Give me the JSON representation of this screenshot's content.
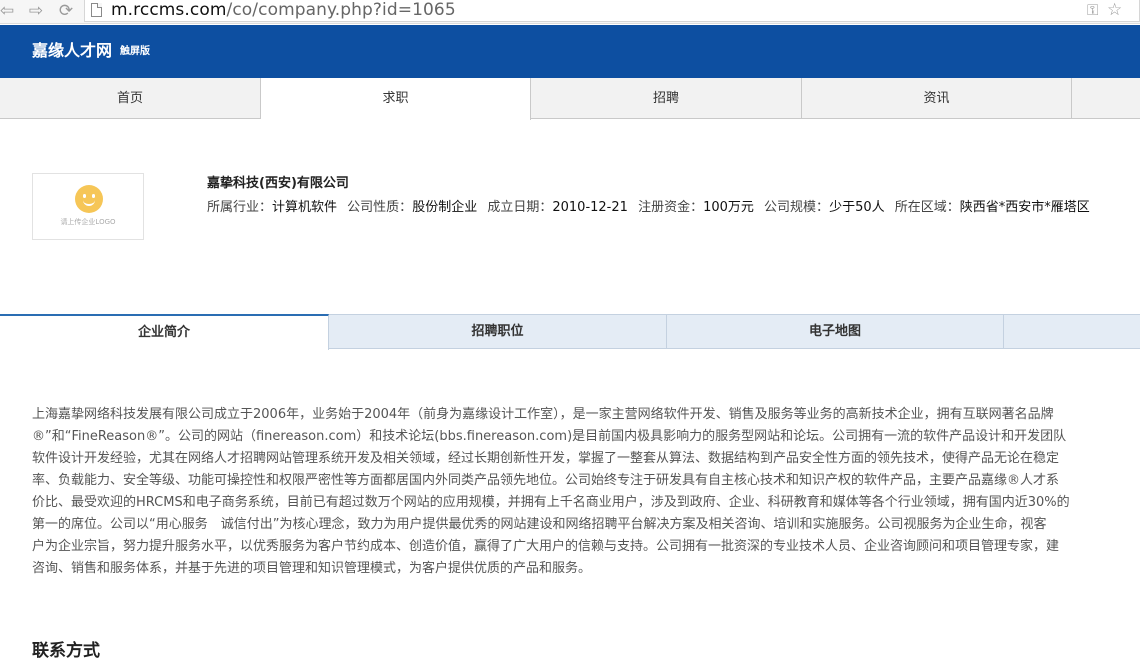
{
  "browser": {
    "url_host": "m.rccms.com",
    "url_path": "/co/company.php?id=1065"
  },
  "header": {
    "title": "嘉缘人才网",
    "subtitle": "触屏版"
  },
  "nav": [
    "首页",
    "求职",
    "招聘",
    "资讯"
  ],
  "company": {
    "logo_caption": "请上传企业LOGO",
    "name": "嘉挚科技(西安)有限公司",
    "meta": [
      {
        "label": "所属行业：",
        "value": "计算机软件"
      },
      {
        "label": "公司性质：",
        "value": "股份制企业"
      },
      {
        "label": "成立日期：",
        "value": "2010-12-21"
      },
      {
        "label": "注册资金：",
        "value": "100万元"
      },
      {
        "label": "公司规模：",
        "value": "少于50人"
      },
      {
        "label": "所在区域：",
        "value": "陕西省*西安市*雁塔区"
      }
    ]
  },
  "section_tabs": [
    "企业简介",
    "招聘职位",
    "电子地图"
  ],
  "intro_lines": [
    "上海嘉挚网络科技发展有限公司成立于2006年，业务始于2004年（前身为嘉缘设计工作室），是一家主营网络软件开发、销售及服务等业务的高新技术企业，拥有互联网著名品牌",
    "®”和“FineReason®”。公司的网站（finereason.com）和技术论坛(bbs.finereason.com)是目前国内极具影响力的服务型网站和论坛。公司拥有一流的软件产品设计和开发团队",
    "软件设计开发经验，尤其在网络人才招聘网站管理系统开发及相关领域，经过长期创新性开发，掌握了一整套从算法、数据结构到产品安全性方面的领先技术，使得产品无论在稳定",
    "率、负载能力、安全等级、功能可操控性和权限严密性等方面都居国内外同类产品领先地位。公司始终专注于研发具有自主核心技术和知识产权的软件产品，主要产品嘉缘®人才系",
    "价比、最受欢迎的HRCMS和电子商务系统，目前已有超过数万个网站的应用规模，并拥有上千名商业用户，涉及到政府、企业、科研教育和媒体等各个行业领域，拥有国内近30%的",
    "第一的席位。公司以“用心服务　诚信付出”为核心理念，致力为用户提供最优秀的网站建设和网络招聘平台解决方案及相关咨询、培训和实施服务。公司视服务为企业生命，视客",
    "户为企业宗旨，努力提升服务水平，以优秀服务为客户节约成本、创造价值，赢得了广大用户的信赖与支持。公司拥有一批资深的专业技术人员、企业咨询顾问和项目管理专家，建",
    "咨询、销售和服务体系，并基于先进的项目管理和知识管理模式，为客户提供优质的产品和服务。"
  ],
  "contact_title": "联系方式"
}
